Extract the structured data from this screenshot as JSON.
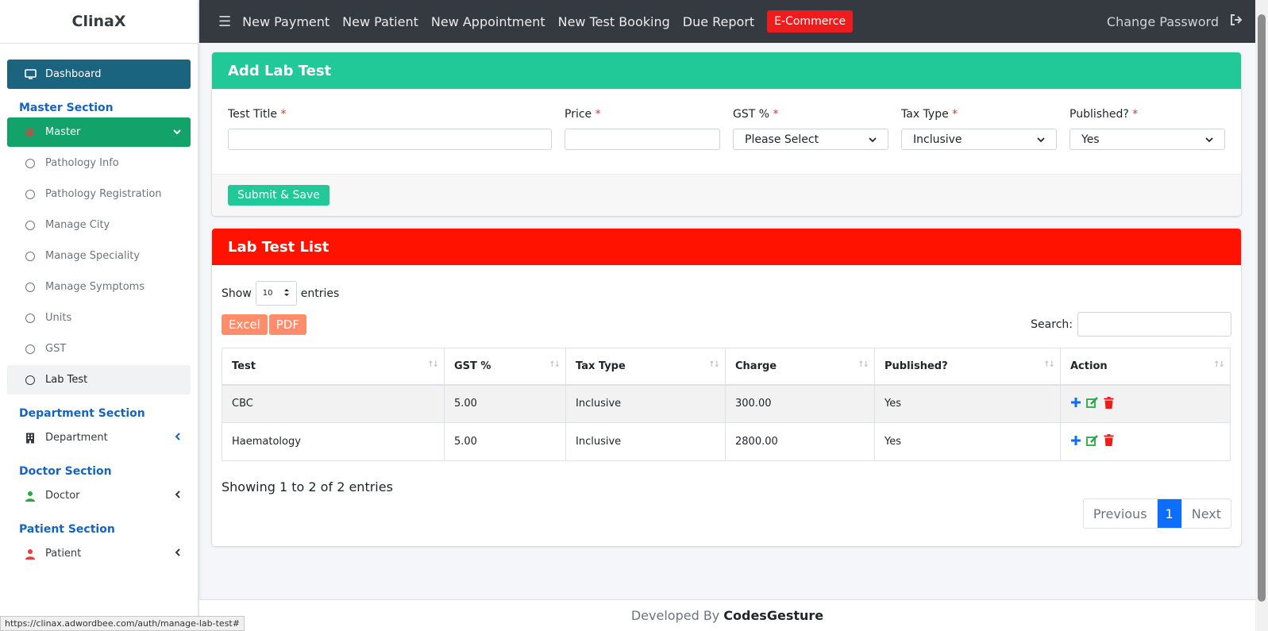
{
  "brand": "ClinaX",
  "sidebar": {
    "dashboard": "Dashboard",
    "master_section": "Master Section",
    "master": "Master",
    "master_items": [
      "Pathology Info",
      "Pathology Registration",
      "Manage City",
      "Manage Speciality",
      "Manage Symptoms",
      "Units",
      "GST",
      "Lab Test"
    ],
    "department_section": "Department Section",
    "department": "Department",
    "doctor_section": "Doctor Section",
    "doctor": "Doctor",
    "patient_section": "Patient Section",
    "patient": "Patient"
  },
  "topbar": {
    "links": [
      "New Payment",
      "New Patient",
      "New Appointment",
      "New Test Booking",
      "Due Report"
    ],
    "ecommerce": "E-Commerce",
    "change_password": "Change Password"
  },
  "add_form": {
    "title": "Add Lab Test",
    "fields": {
      "test_title": "Test Title",
      "price": "Price",
      "gst": "GST %",
      "tax_type": "Tax Type",
      "published": "Published?"
    },
    "required_mark": "*",
    "gst_value": "Please Select",
    "tax_type_value": "Inclusive",
    "published_value": "Yes",
    "submit": "Submit & Save"
  },
  "list": {
    "title": "Lab Test List",
    "show": "Show",
    "entries": "entries",
    "length_value": "10",
    "excel": "Excel",
    "pdf": "PDF",
    "search_label": "Search:",
    "columns": [
      "Test",
      "GST %",
      "Tax Type",
      "Charge",
      "Published?",
      "Action"
    ],
    "rows": [
      [
        "CBC",
        "5.00",
        "Inclusive",
        "300.00",
        "Yes"
      ],
      [
        "Haematology",
        "5.00",
        "Inclusive",
        "2800.00",
        "Yes"
      ]
    ],
    "info": "Showing 1 to 2 of 2 entries",
    "previous": "Previous",
    "page": "1",
    "next": "Next"
  },
  "footer": {
    "prefix": "Developed By",
    "company": "CodesGesture"
  },
  "status_url": "https://clinax.adwordbee.com/auth/manage-lab-test#",
  "colors": {
    "dashboard": "#1a6480",
    "master": "#12a26a",
    "add_header": "#20c997",
    "list_header": "#ff1200",
    "topbar": "#343a40",
    "section_head": "#1565c0"
  }
}
